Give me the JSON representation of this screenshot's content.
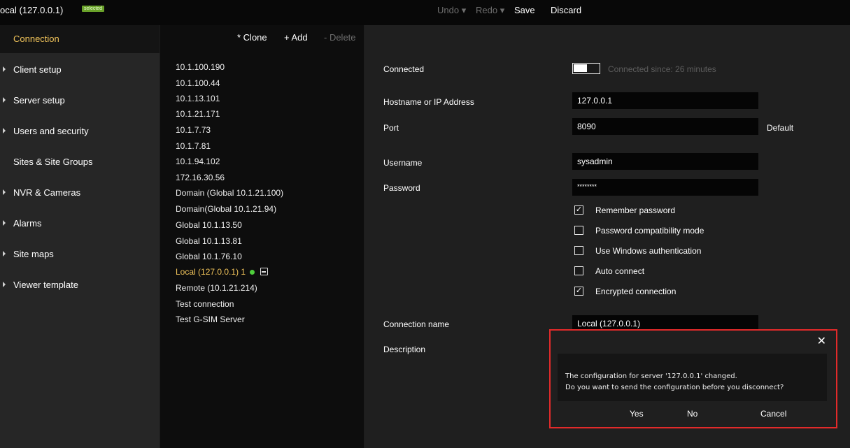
{
  "window": {
    "title": "ocal (127.0.0.1)",
    "badge": "selected"
  },
  "toolbar": {
    "undo": "Undo ▾",
    "redo": "Redo ▾",
    "save": "Save",
    "discard": "Discard"
  },
  "sidebar": {
    "items": [
      {
        "label": "Connection",
        "active": true,
        "arrow": false
      },
      {
        "label": "Client setup",
        "active": false,
        "arrow": true
      },
      {
        "label": "Server setup",
        "active": false,
        "arrow": true
      },
      {
        "label": "Users and security",
        "active": false,
        "arrow": true
      },
      {
        "label": "Sites & Site Groups",
        "active": false,
        "arrow": false
      },
      {
        "label": "NVR & Cameras",
        "active": false,
        "arrow": true
      },
      {
        "label": "Alarms",
        "active": false,
        "arrow": true
      },
      {
        "label": "Site maps",
        "active": false,
        "arrow": true
      },
      {
        "label": "Viewer template",
        "active": false,
        "arrow": true
      }
    ]
  },
  "list": {
    "clone": "* Clone",
    "add": "+ Add",
    "delete": "- Delete",
    "connections": [
      "10.1.100.190",
      "10.1.100.44",
      "10.1.13.101",
      "10.1.21.171",
      "10.1.7.73",
      "10.1.7.81",
      "10.1.94.102",
      "172.16.30.56",
      "Domain (Global 10.1.21.100)",
      "Domain(Global 10.1.21.94)",
      "Global 10.1.13.50",
      "Global 10.1.13.81",
      "Global 10.1.76.10",
      "Local (127.0.0.1) 1",
      "Remote (10.1.21.214)",
      "Test connection",
      "Test G-SIM Server"
    ]
  },
  "detail": {
    "connected_label": "Connected",
    "connected_since": "Connected since:   26 minutes",
    "host_label": "Hostname or IP Address",
    "host_value": "127.0.0.1",
    "port_label": "Port",
    "port_value": "8090",
    "default_label": "Default",
    "username_label": "Username",
    "username_value": "sysadmin",
    "password_label": "Password",
    "password_value": "********",
    "checkboxes": [
      {
        "label": "Remember password",
        "checked": true
      },
      {
        "label": "Password compatibility mode",
        "checked": false
      },
      {
        "label": "Use Windows authentication",
        "checked": false
      },
      {
        "label": "Auto connect",
        "checked": false
      },
      {
        "label": "Encrypted connection",
        "checked": true
      }
    ],
    "conn_name_label": "Connection name",
    "conn_name_value": "Local (127.0.0.1)",
    "description_label": "Description"
  },
  "dialog": {
    "close": "✕",
    "line1": "The configuration for server '127.0.0.1' changed.",
    "line2": "Do you want to send the configuration before you disconnect?",
    "yes": "Yes",
    "no": "No",
    "cancel": "Cancel"
  },
  "colors": {
    "accent": "#f0c35a",
    "badge": "#6aa22a",
    "dialog_border": "#e22a2a",
    "status_ok": "#4fcf3c"
  }
}
